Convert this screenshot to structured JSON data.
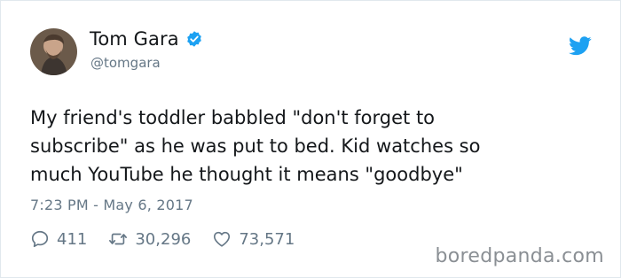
{
  "author": {
    "name": "Tom Gara",
    "handle": "@tomgara"
  },
  "tweet": {
    "text": "My friend's toddler babbled \"don't forget to\nsubscribe\" as he was put to bed. Kid watches so\nmuch YouTube he thought it means \"goodbye\"",
    "timestamp": "7:23 PM - May 6, 2017"
  },
  "stats": {
    "replies": "411",
    "retweets": "30,296",
    "likes": "73,571"
  },
  "watermark": "boredpanda.com",
  "icons": {
    "verified": "verified-badge-icon",
    "platform": "twitter-bird-icon",
    "reply": "reply-icon",
    "retweet": "retweet-icon",
    "like": "heart-icon"
  },
  "colors": {
    "accent": "#1da1f2",
    "secondary_text": "#657786",
    "primary_text": "#14171a"
  }
}
